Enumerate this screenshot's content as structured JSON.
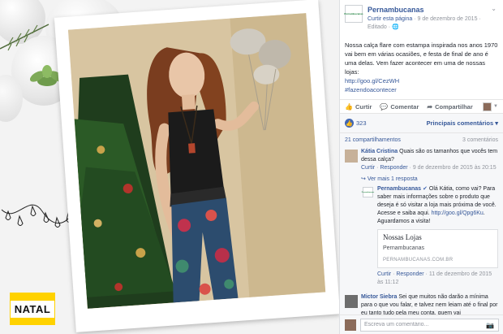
{
  "post": {
    "page_name": "Pernambucanas",
    "page_avatar_text": "Pernambucanas",
    "follow_label": "Curtir esta página",
    "separator": "·",
    "date": "9 de dezembro de 2015",
    "edited": "Editado",
    "globe": "🌐",
    "text_lines": [
      "Nossa calça flare com estampa inspirada nos anos",
      "1970 vai bem em várias ocasiões, e festa de final",
      "de ano é uma delas. Vem fazer acontecer em uma",
      "de nossas lojas:"
    ],
    "link": "http://goo.gl/CezWH",
    "hashtag": "#fazendoacontecer"
  },
  "actions": {
    "like": "Curtir",
    "comment": "Comentar",
    "share": "Compartilhar",
    "like_icon": "thumbs-up-icon",
    "comment_icon": "speech-bubble-icon",
    "share_icon": "share-arrow-icon"
  },
  "stats": {
    "likes": "323",
    "sort": "Principais comentários ▾",
    "shares": "21 compartilhamentos",
    "comments_count": "3 comentários"
  },
  "comments": [
    {
      "name": "Kátia Cristina",
      "text": "Quais são os tamanhos que vocês tem dessa calça?",
      "like": "Curtir",
      "reply": "Responder",
      "date": "9 de dezembro de 2015 às 20:15",
      "more_replies": "Ver mais 1 resposta"
    },
    {
      "name": "Mictor Siebra",
      "text": "Sei que muitos não darão a mínima para o que vou falar, e talvez nem leiam até o final por eu tanto tudo pela meu conta, quem vai"
    }
  ],
  "reply": {
    "name": "Pernambucanas",
    "text": "Olá Kátia, como vai? Para saber mais informações sobre o produto que deseja é só visitar a loja mais próxima de você. Acesse e saiba aqui.",
    "link": "http://goo.gl/Qpg6Ku",
    "text_after": ". Aguardamos a visita!",
    "card": {
      "title": "Nossas Lojas",
      "subtitle": "Pernambucanas",
      "domain": "PERNAMBUCANAS.COM.BR"
    },
    "like": "Curtir",
    "reply": "Responder",
    "date": "11 de dezembro de 2015 às 11:12"
  },
  "comment_input": {
    "placeholder": "Escreva um comentário...",
    "camera_icon": "camera-icon"
  },
  "badge": {
    "text": "NATAL"
  },
  "colors": {
    "fb_link": "#365899",
    "fb_meta": "#90949c",
    "badge_yellow": "#ffd200"
  }
}
